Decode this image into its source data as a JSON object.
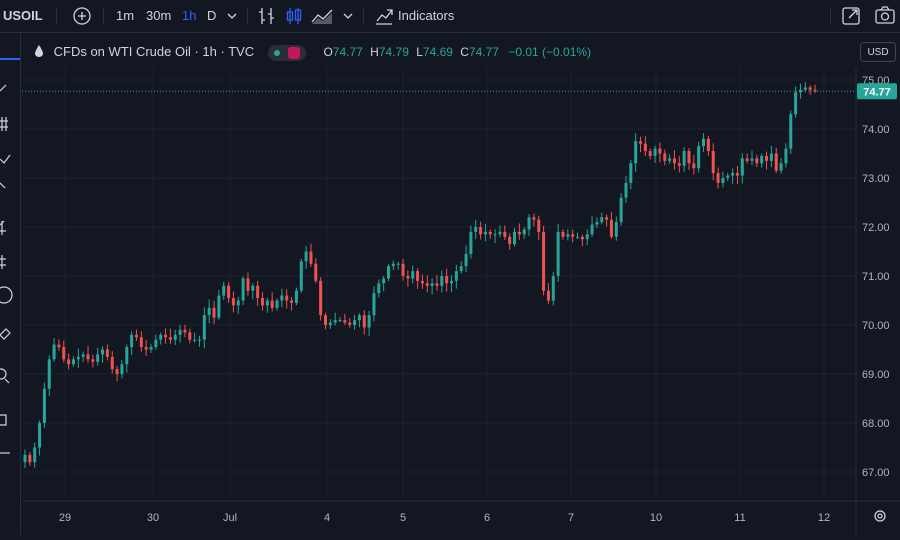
{
  "toolbar": {
    "symbol": "USOIL",
    "intervals": [
      {
        "label": "1m",
        "active": false
      },
      {
        "label": "30m",
        "active": false
      },
      {
        "label": "1h",
        "active": true
      },
      {
        "label": "D",
        "active": false
      }
    ],
    "indicators_label": "Indicators",
    "icons": [
      "add-symbol-icon",
      "interval-dropdown-icon",
      "bar-style-icon",
      "candles-icon",
      "area-chart-icon",
      "chart-type-dropdown-icon",
      "indicators-icon",
      "snapshot-icon",
      "camera-icon"
    ]
  },
  "legend": {
    "title": "CFDs on WTI Crude Oil · 1h · TVC",
    "open_label": "O",
    "open": "74.77",
    "high_label": "H",
    "high": "74.79",
    "low_label": "L",
    "low": "74.69",
    "close_label": "C",
    "close": "74.77",
    "change": "−0.01 (−0.01%)"
  },
  "currency": "USD",
  "colors": {
    "up": "#26a69a",
    "down": "#ef5350",
    "background": "#131722",
    "grid": "#1e222d"
  },
  "chart_data": {
    "type": "candlestick",
    "price_axis": [
      "75.00",
      "74.00",
      "73.00",
      "72.00",
      "71.00",
      "70.00",
      "69.00",
      "68.00",
      "67.00"
    ],
    "ylim": [
      66.6,
      75.25
    ],
    "time_axis": [
      "29",
      "30",
      "Jul",
      "4",
      "5",
      "6",
      "7",
      "10",
      "11",
      "12"
    ],
    "last_price": "74.77",
    "series_close": [
      67.35,
      67.2,
      67.5,
      68.0,
      68.7,
      69.3,
      69.6,
      69.55,
      69.3,
      69.2,
      69.3,
      69.35,
      69.4,
      69.3,
      69.25,
      69.4,
      69.5,
      69.35,
      69.1,
      69.0,
      69.2,
      69.55,
      69.8,
      69.75,
      69.55,
      69.5,
      69.55,
      69.7,
      69.8,
      69.75,
      69.7,
      69.8,
      69.9,
      69.85,
      69.7,
      69.7,
      69.7,
      70.2,
      70.35,
      70.15,
      70.6,
      70.8,
      70.55,
      70.4,
      70.5,
      70.95,
      70.7,
      70.8,
      70.55,
      70.4,
      70.5,
      70.35,
      70.5,
      70.6,
      70.5,
      70.45,
      70.7,
      71.3,
      71.5,
      71.25,
      70.9,
      70.2,
      70.0,
      70.05,
      70.1,
      70.1,
      70.05,
      70.0,
      70.1,
      70.2,
      69.95,
      70.2,
      70.65,
      70.85,
      70.95,
      71.2,
      71.25,
      71.25,
      71.0,
      70.95,
      71.1,
      70.9,
      70.85,
      70.8,
      70.85,
      70.8,
      71.0,
      70.85,
      70.9,
      71.1,
      71.2,
      71.45,
      71.9,
      72.0,
      71.85,
      71.9,
      71.85,
      71.85,
      71.9,
      71.8,
      71.65,
      71.9,
      71.85,
      71.95,
      72.2,
      72.15,
      71.9,
      70.7,
      70.5,
      71.0,
      71.9,
      71.8,
      71.85,
      71.8,
      71.8,
      71.75,
      71.85,
      72.05,
      72.1,
      72.2,
      72.15,
      71.8,
      72.1,
      72.6,
      72.9,
      73.3,
      73.75,
      73.7,
      73.55,
      73.45,
      73.6,
      73.5,
      73.35,
      73.4,
      73.3,
      73.25,
      73.55,
      73.3,
      73.2,
      73.65,
      73.8,
      73.55,
      73.1,
      72.9,
      73.0,
      73.05,
      73.1,
      73.05,
      73.4,
      73.35,
      73.4,
      73.3,
      73.45,
      73.35,
      73.5,
      73.15,
      73.3,
      73.6,
      74.3,
      74.75,
      74.8,
      74.85,
      74.8,
      74.77
    ],
    "candle_count": 164,
    "x_start": 25,
    "x_end": 815
  }
}
